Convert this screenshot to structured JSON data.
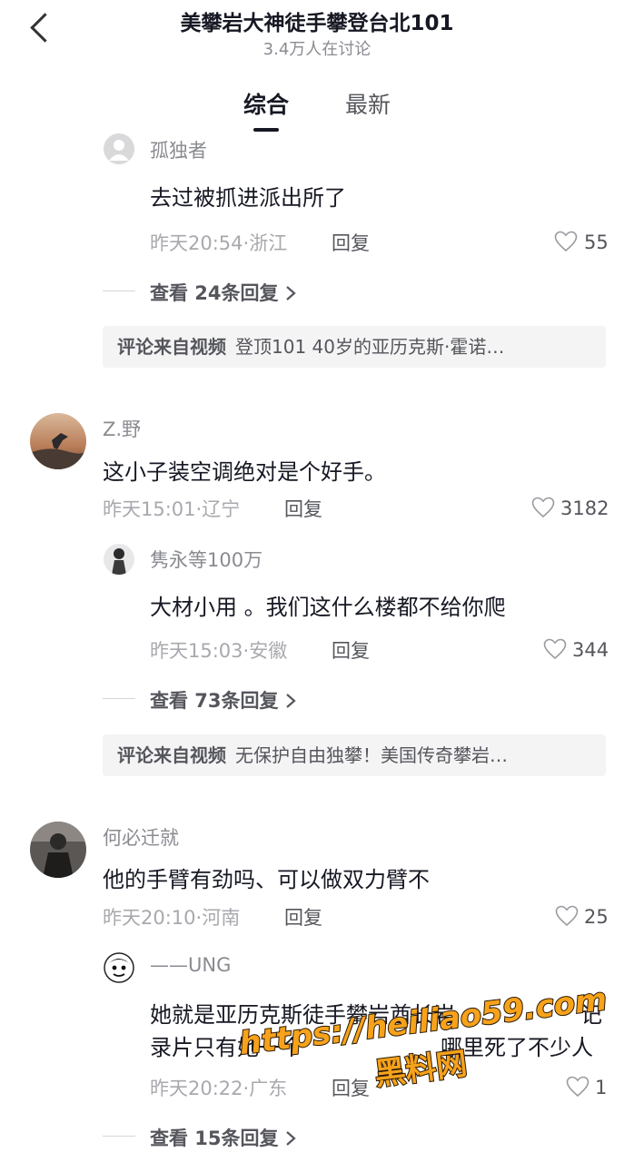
{
  "header": {
    "title": "美攀岩大神徒手攀登台北101",
    "subtitle": "3.4万人在讨论"
  },
  "tabs": [
    {
      "label": "综合",
      "active": true
    },
    {
      "label": "最新",
      "active": false
    }
  ],
  "comments": [
    {
      "user": "孤独者",
      "text": "去过被抓进派出所了",
      "time_location": "昨天20:54·浙江",
      "reply_label": "回复",
      "likes": "55",
      "view_more": "查看 24条回复",
      "source_label": "评论来自视频",
      "source_title": "登顶101 40岁的亚历克斯·霍诺…"
    },
    {
      "user": "Z.野",
      "text": "这小子装空调绝对是个好手。",
      "time_location": "昨天15:01·辽宁",
      "reply_label": "回复",
      "likes": "3182",
      "reply": {
        "user": "隽永等100万",
        "text": "大材小用 。我们这什么楼都不给你爬",
        "time_location": "昨天15:03·安徽",
        "reply_label": "回复",
        "likes": "344"
      },
      "view_more": "查看 73条回复",
      "source_label": "评论来自视频",
      "source_title": "无保护自由独攀！美国传奇攀岩…"
    },
    {
      "user": "何必迁就",
      "text": "他的手臂有劲吗、可以做双力臂不",
      "time_location": "昨天20:10·河南",
      "reply_label": "回复",
      "likes": "25",
      "reply": {
        "user": "——UNG",
        "text_line1": "她就是亚历克斯徒手攀岩酋长岩",
        "text_line2": "录片只有她一个",
        "text_tail1": "记",
        "text_tail2": "哪里死了不少人",
        "time_location": "昨天20:22·广东",
        "reply_label": "回复",
        "likes": "1"
      },
      "view_more": "查看 15条回复"
    }
  ],
  "watermark": {
    "url": "https://heiliao59.com",
    "name": "黑料网"
  },
  "icons": {
    "back": "chevron-left-icon",
    "like": "heart-outline-icon",
    "more": "chevron-right-icon"
  },
  "colors": {
    "text_primary": "#161823",
    "text_secondary": "#8a8b91",
    "watermark_fill": "#f7a21b"
  }
}
